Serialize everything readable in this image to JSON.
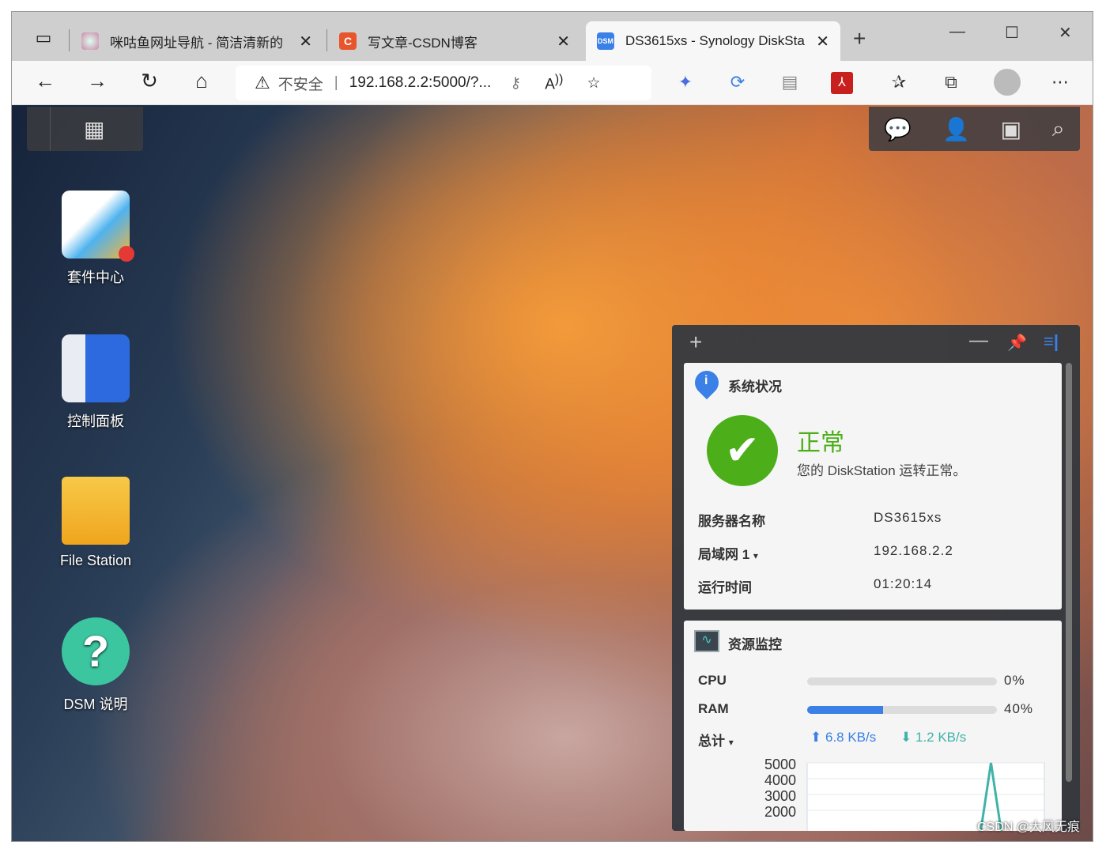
{
  "browser": {
    "tabs": [
      {
        "title": "咪咕鱼网址导航 - 简洁清新的",
        "icon": "globe-favicon"
      },
      {
        "title": "写文章-CSDN博客",
        "icon": "csdn-favicon",
        "icon_text": "C"
      },
      {
        "title": "DS3615xs - Synology DiskSta",
        "icon": "dsm-favicon",
        "icon_text": "DSM",
        "active": true
      }
    ],
    "address": {
      "security": "不安全",
      "url": "192.168.2.2:5000/?..."
    }
  },
  "desktop": {
    "icons": [
      {
        "label": "套件中心",
        "icon": "package-center-icon"
      },
      {
        "label": "控制面板",
        "icon": "control-panel-icon"
      },
      {
        "label": "File Station",
        "icon": "file-station-icon"
      },
      {
        "label": "DSM 说明",
        "icon": "help-icon"
      }
    ]
  },
  "widget": {
    "system": {
      "title": "系统状况",
      "status": "正常",
      "status_desc": "您的 DiskStation 运转正常。",
      "rows": [
        {
          "label": "服务器名称",
          "value": "DS3615xs"
        },
        {
          "label": "局域网 1",
          "value": "192.168.2.2"
        },
        {
          "label": "运行时间",
          "value": "01:20:14"
        }
      ]
    },
    "resource": {
      "title": "资源监控",
      "cpu_label": "CPU",
      "cpu_percent": 0,
      "cpu_text": "0%",
      "ram_label": "RAM",
      "ram_percent": 40,
      "ram_text": "40%",
      "net_label": "总计",
      "upload": "6.8 KB/s",
      "download": "1.2 KB/s",
      "colors": {
        "upload": "#3a80e6",
        "download": "#3fb3a8",
        "status": "#4caf1a"
      }
    }
  },
  "chart_data": {
    "type": "line",
    "yticks": [
      "5000",
      "4000",
      "3000",
      "2000"
    ],
    "series": [
      {
        "values": [
          0,
          0,
          0,
          0,
          0,
          0,
          0,
          0,
          0,
          0,
          0,
          0,
          0,
          0,
          0,
          5000,
          0,
          0,
          0,
          0
        ]
      }
    ],
    "ylim": [
      0,
      5000
    ]
  },
  "watermark": "CSDN @大风无痕"
}
